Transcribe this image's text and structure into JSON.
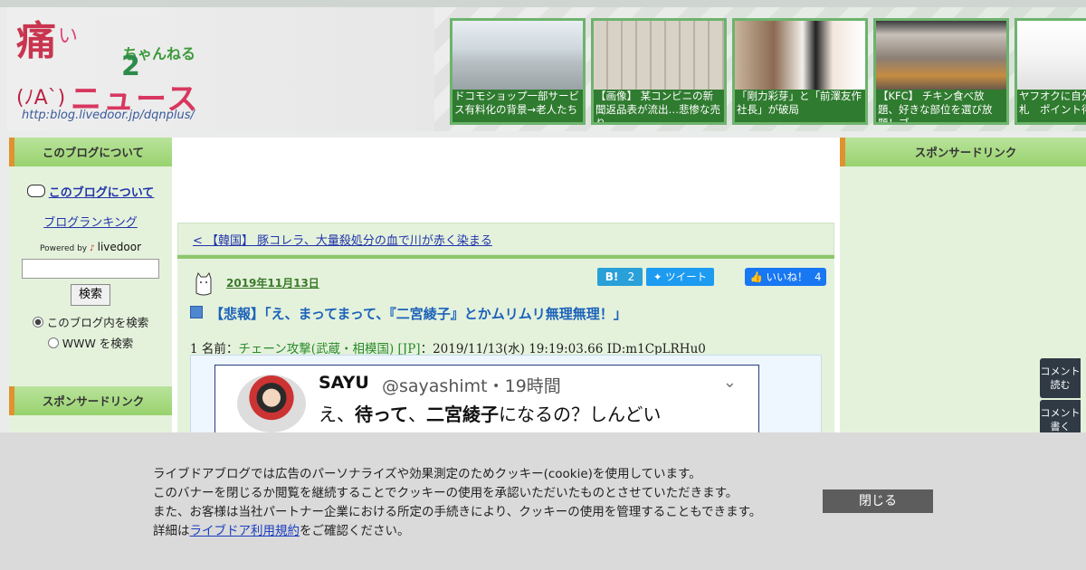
{
  "header": {
    "logo": {
      "kanji": "痛",
      "small": "い",
      "chan": "ちゃんねる",
      "two": "2",
      "face": "(ﾉA`)",
      "news": "ニュース",
      "url": "http:blog.livedoor.jp/dqnplus/"
    },
    "thumbs": [
      {
        "caption": "ドコモショップ一部サービス有料化の背景→老人たち"
      },
      {
        "caption": "【画像】 某コンビニの新聞返品表が流出…悲惨な売り"
      },
      {
        "caption": "「剛力彩芽」と「前澤友作社長」が破局"
      },
      {
        "caption": "【KFC】 チキン食べ放題、好きな部位を選び放題！ブ"
      },
      {
        "caption": "ヤフオクに自分で出品で落札　ポイント得"
      }
    ]
  },
  "left_sidebar": {
    "about_header": "このブログについて",
    "about_link": "このブログについて",
    "ranking_link": "ブログランキング",
    "powered_by": "Powered by",
    "powered_brand": "livedoor",
    "search_button": "検索",
    "radio_blog": "このブログ内を検索",
    "radio_www": "WWW を検索",
    "sponsor_header": "スポンサードリンク"
  },
  "right_sidebar": {
    "sponsor_header": "スポンサードリンク"
  },
  "main": {
    "prev_link": "< 【韓国】 豚コレラ、大量殺処分の血で川が赤く染まる",
    "date": "2019年11月13日",
    "hatena_label": "B!",
    "hatena_count": "2",
    "tweet_label": "ツイート",
    "like_label": "いいね！",
    "like_count": "4",
    "title": "【悲報】「え、まってまって、『二宮綾子』とかムリムリ無理無理！」",
    "post_meta_prefix": "1 名前：",
    "post_name": "チェーン攻撃(武蔵・相模国) [JP]",
    "post_meta_suffix": "：2019/11/13(水) 19:19:03.66 ID:m1CpLRHu0",
    "tweet": {
      "name": "SAYU",
      "handle": "@sayashimt・19時間",
      "text_before": "え、",
      "text_bold1": "待って",
      "text_mid": "、",
      "text_bold2": "二宮綾子",
      "text_after": "になるの？しんどい",
      "chevron": "⌄"
    }
  },
  "side_buttons": {
    "read": "コメント読む",
    "write": "コメント書く"
  },
  "cookie_banner": {
    "line1": "ライブドアブログでは広告のパーソナライズや効果測定のためクッキー(cookie)を使用しています。",
    "line2": "このバナーを閉じるか閲覧を継続することでクッキーの使用を承認いただいたものとさせていただきます。",
    "line3": "また、お客様は当社パートナー企業における所定の手続きにより、クッキーの使用を管理することもできます。",
    "line4_prefix": "詳細は",
    "line4_link": "ライブドア利用規約",
    "line4_suffix": "をご確認ください。",
    "close_button": "閉じる"
  }
}
